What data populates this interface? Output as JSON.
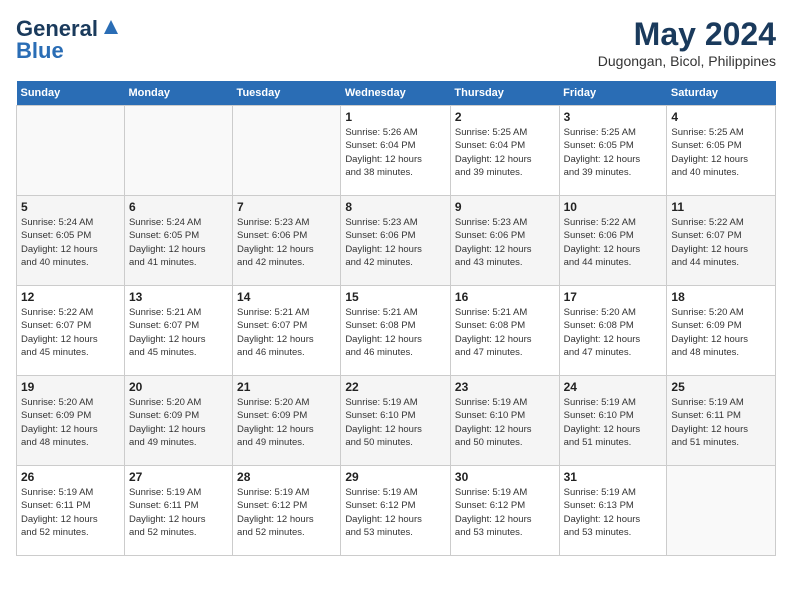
{
  "header": {
    "logo_line1": "General",
    "logo_line2": "Blue",
    "month_year": "May 2024",
    "location": "Dugongan, Bicol, Philippines"
  },
  "days_of_week": [
    "Sunday",
    "Monday",
    "Tuesday",
    "Wednesday",
    "Thursday",
    "Friday",
    "Saturday"
  ],
  "weeks": [
    [
      {
        "day": "",
        "text": ""
      },
      {
        "day": "",
        "text": ""
      },
      {
        "day": "",
        "text": ""
      },
      {
        "day": "1",
        "text": "Sunrise: 5:26 AM\nSunset: 6:04 PM\nDaylight: 12 hours\nand 38 minutes."
      },
      {
        "day": "2",
        "text": "Sunrise: 5:25 AM\nSunset: 6:04 PM\nDaylight: 12 hours\nand 39 minutes."
      },
      {
        "day": "3",
        "text": "Sunrise: 5:25 AM\nSunset: 6:05 PM\nDaylight: 12 hours\nand 39 minutes."
      },
      {
        "day": "4",
        "text": "Sunrise: 5:25 AM\nSunset: 6:05 PM\nDaylight: 12 hours\nand 40 minutes."
      }
    ],
    [
      {
        "day": "5",
        "text": "Sunrise: 5:24 AM\nSunset: 6:05 PM\nDaylight: 12 hours\nand 40 minutes."
      },
      {
        "day": "6",
        "text": "Sunrise: 5:24 AM\nSunset: 6:05 PM\nDaylight: 12 hours\nand 41 minutes."
      },
      {
        "day": "7",
        "text": "Sunrise: 5:23 AM\nSunset: 6:06 PM\nDaylight: 12 hours\nand 42 minutes."
      },
      {
        "day": "8",
        "text": "Sunrise: 5:23 AM\nSunset: 6:06 PM\nDaylight: 12 hours\nand 42 minutes."
      },
      {
        "day": "9",
        "text": "Sunrise: 5:23 AM\nSunset: 6:06 PM\nDaylight: 12 hours\nand 43 minutes."
      },
      {
        "day": "10",
        "text": "Sunrise: 5:22 AM\nSunset: 6:06 PM\nDaylight: 12 hours\nand 44 minutes."
      },
      {
        "day": "11",
        "text": "Sunrise: 5:22 AM\nSunset: 6:07 PM\nDaylight: 12 hours\nand 44 minutes."
      }
    ],
    [
      {
        "day": "12",
        "text": "Sunrise: 5:22 AM\nSunset: 6:07 PM\nDaylight: 12 hours\nand 45 minutes."
      },
      {
        "day": "13",
        "text": "Sunrise: 5:21 AM\nSunset: 6:07 PM\nDaylight: 12 hours\nand 45 minutes."
      },
      {
        "day": "14",
        "text": "Sunrise: 5:21 AM\nSunset: 6:07 PM\nDaylight: 12 hours\nand 46 minutes."
      },
      {
        "day": "15",
        "text": "Sunrise: 5:21 AM\nSunset: 6:08 PM\nDaylight: 12 hours\nand 46 minutes."
      },
      {
        "day": "16",
        "text": "Sunrise: 5:21 AM\nSunset: 6:08 PM\nDaylight: 12 hours\nand 47 minutes."
      },
      {
        "day": "17",
        "text": "Sunrise: 5:20 AM\nSunset: 6:08 PM\nDaylight: 12 hours\nand 47 minutes."
      },
      {
        "day": "18",
        "text": "Sunrise: 5:20 AM\nSunset: 6:09 PM\nDaylight: 12 hours\nand 48 minutes."
      }
    ],
    [
      {
        "day": "19",
        "text": "Sunrise: 5:20 AM\nSunset: 6:09 PM\nDaylight: 12 hours\nand 48 minutes."
      },
      {
        "day": "20",
        "text": "Sunrise: 5:20 AM\nSunset: 6:09 PM\nDaylight: 12 hours\nand 49 minutes."
      },
      {
        "day": "21",
        "text": "Sunrise: 5:20 AM\nSunset: 6:09 PM\nDaylight: 12 hours\nand 49 minutes."
      },
      {
        "day": "22",
        "text": "Sunrise: 5:19 AM\nSunset: 6:10 PM\nDaylight: 12 hours\nand 50 minutes."
      },
      {
        "day": "23",
        "text": "Sunrise: 5:19 AM\nSunset: 6:10 PM\nDaylight: 12 hours\nand 50 minutes."
      },
      {
        "day": "24",
        "text": "Sunrise: 5:19 AM\nSunset: 6:10 PM\nDaylight: 12 hours\nand 51 minutes."
      },
      {
        "day": "25",
        "text": "Sunrise: 5:19 AM\nSunset: 6:11 PM\nDaylight: 12 hours\nand 51 minutes."
      }
    ],
    [
      {
        "day": "26",
        "text": "Sunrise: 5:19 AM\nSunset: 6:11 PM\nDaylight: 12 hours\nand 52 minutes."
      },
      {
        "day": "27",
        "text": "Sunrise: 5:19 AM\nSunset: 6:11 PM\nDaylight: 12 hours\nand 52 minutes."
      },
      {
        "day": "28",
        "text": "Sunrise: 5:19 AM\nSunset: 6:12 PM\nDaylight: 12 hours\nand 52 minutes."
      },
      {
        "day": "29",
        "text": "Sunrise: 5:19 AM\nSunset: 6:12 PM\nDaylight: 12 hours\nand 53 minutes."
      },
      {
        "day": "30",
        "text": "Sunrise: 5:19 AM\nSunset: 6:12 PM\nDaylight: 12 hours\nand 53 minutes."
      },
      {
        "day": "31",
        "text": "Sunrise: 5:19 AM\nSunset: 6:13 PM\nDaylight: 12 hours\nand 53 minutes."
      },
      {
        "day": "",
        "text": ""
      }
    ]
  ]
}
